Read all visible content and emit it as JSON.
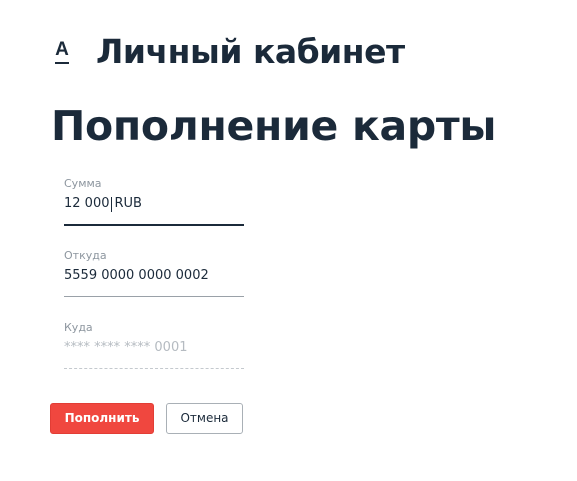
{
  "brand": {
    "logo_letter": "А",
    "app_title": "Личный кабинет"
  },
  "page": {
    "title": "Пополнение карты"
  },
  "form": {
    "amount": {
      "label": "Сумма",
      "value": "12 000",
      "currency": "RUB"
    },
    "from": {
      "label": "Откуда",
      "value": "5559 0000 0000 0002"
    },
    "to": {
      "label": "Куда",
      "placeholder": "**** **** **** 0001"
    }
  },
  "actions": {
    "submit_label": "Пополнить",
    "cancel_label": "Отмена"
  },
  "colors": {
    "primary": "#f0473f",
    "text": "#1b2a3a",
    "muted": "#8d969f"
  }
}
